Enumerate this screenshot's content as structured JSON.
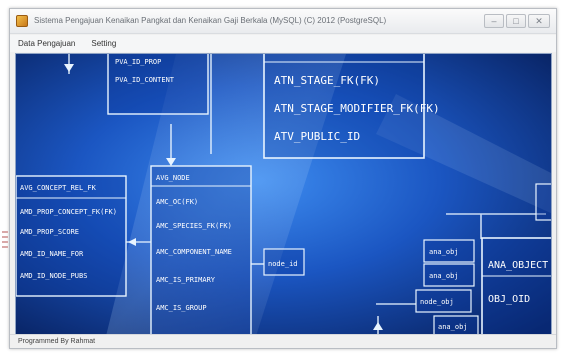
{
  "window": {
    "title": "Sistema Pengajuan Kenaikan Pangkat dan Kenaikan Gaji Berkala (MySQL) (C) 2012 (PostgreSQL)",
    "minimize_symbol": "–",
    "maximize_symbol": "□",
    "close_symbol": "✕"
  },
  "menu": {
    "items": [
      {
        "label": "Data Pengajuan"
      },
      {
        "label": "Setting"
      }
    ]
  },
  "status": {
    "text": "Programmed By Rahmat"
  },
  "background_art": {
    "colors": {
      "deep": "#0a2d7a",
      "mid": "#1f5fc9",
      "glow": "#6fb4ff",
      "line": "#e8f4ff"
    },
    "labels": [
      "PVA_ID_PROP",
      "PVA_ID_CONTENT",
      "ATN_STAGE_FK(FK)",
      "ATN_STAGE_MODIFIER_FK(FK)",
      "ATV_PUBLIC_ID",
      "AVG_CONCEPT_REL_FK",
      "AMD_PROP_CONCEPT_FK(FK)",
      "AMD_PROP_SCORE",
      "AMD_ID_NAME_FOR",
      "AMD_ID_NODE_PUBS",
      "AVG_NODE",
      "AMC_OC(FK)",
      "AMC_SPECIES_FK(FK)",
      "AMC_COMPONENT_NAME",
      "AMC_IS_PRIMARY",
      "AMC_IS_GROUP",
      "node_id",
      "ana_obj",
      "ana_obj",
      "node_obj",
      "ana_obj",
      "ANA_OBJECT",
      "OBJ_OID"
    ]
  }
}
